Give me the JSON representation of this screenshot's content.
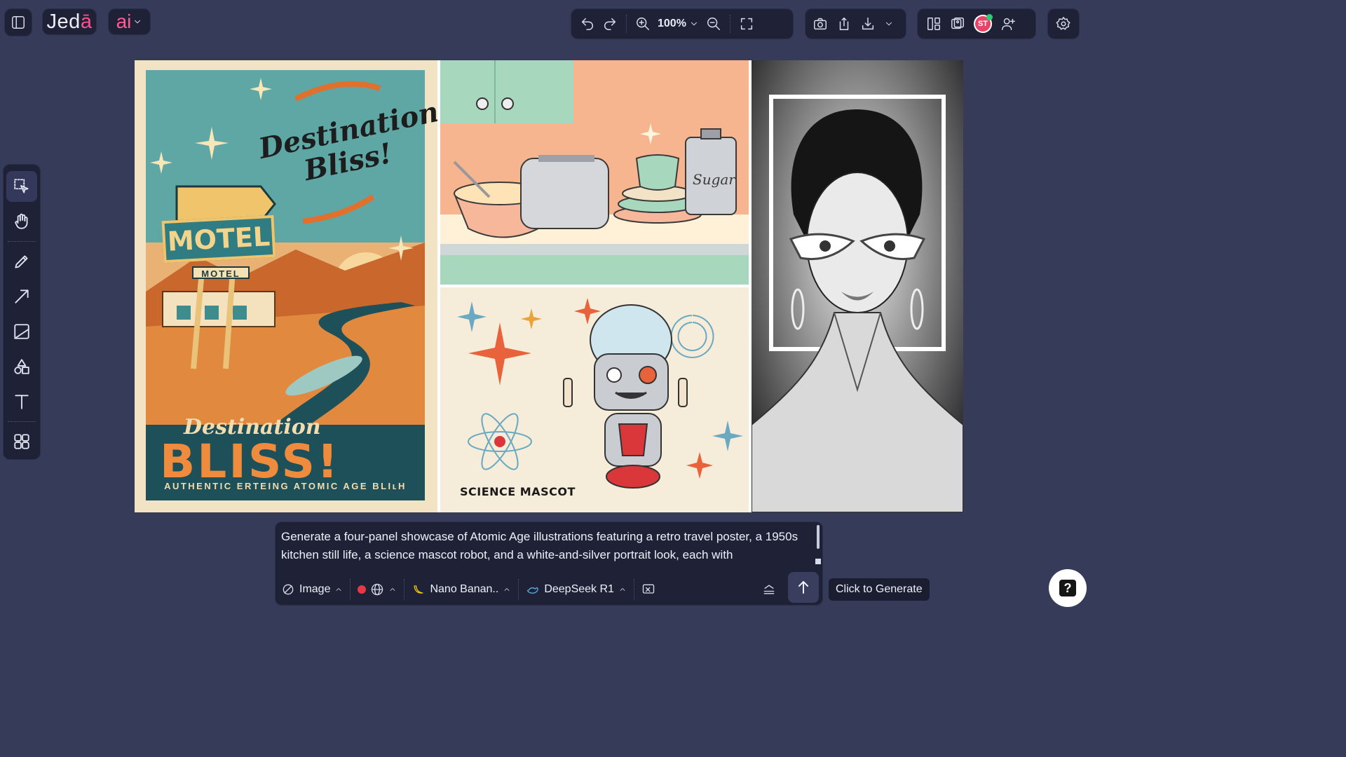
{
  "brand": {
    "name_main": "Jed",
    "name_accent": "ā"
  },
  "ai_menu": {
    "label": "ai"
  },
  "toolbar": {
    "zoom": "100%"
  },
  "user": {
    "initials": "ST"
  },
  "canvas": {
    "poster": {
      "headline": "Destination Bliss!",
      "sign": "MOTEL",
      "sign_sub": "MOTEL",
      "footer_script": "Destination",
      "footer_big": "BLISS!",
      "footer_tag": "AUTHENTIC ERTEING ATOMIC AGE BLIʟH"
    },
    "kitchen": {
      "jar_label": "Sugar"
    },
    "robot": {
      "label": "SCIENCE MASCOT"
    }
  },
  "prompt": {
    "text": "Generate a four-panel showcase of Atomic Age illustrations featuring a retro travel poster, a 1950s kitchen still life, a science mascot robot, and a white-and-silver portrait look, each with",
    "mode": "Image",
    "image_model": "Nano Banan..",
    "text_model": "DeepSeek R1"
  },
  "tooltip": {
    "generate": "Click to Generate"
  },
  "help": {
    "label": "?"
  },
  "colors": {
    "background": "#373b5a",
    "panel": "#1f2237",
    "accent": "#ff4f8e"
  }
}
